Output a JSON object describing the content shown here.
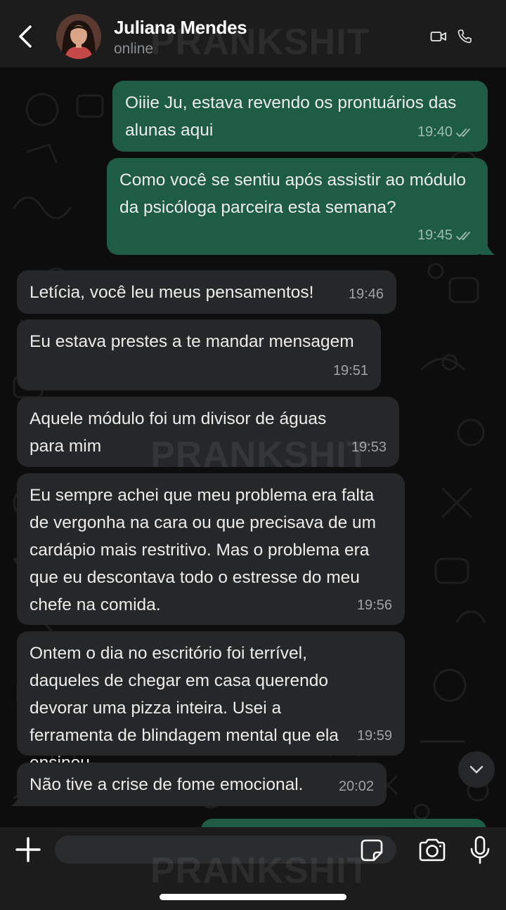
{
  "contact": {
    "name": "Juliana Mendes",
    "status": "online"
  },
  "watermark": "PRANKSHIT",
  "messages": [
    {
      "direction": "out",
      "text": "Oiiie Ju, estava revendo os prontuários das alunas aqui",
      "time": "19:40",
      "read": true
    },
    {
      "direction": "out",
      "text": "Como você se sentiu após assistir ao módulo da psicóloga parceira esta semana?",
      "time": "19:45",
      "read": true
    },
    {
      "direction": "in",
      "text": "Letícia, você leu meus pensamentos!",
      "time": "19:46"
    },
    {
      "direction": "in",
      "text": "Eu estava prestes a te mandar mensagem",
      "time": "19:51"
    },
    {
      "direction": "in",
      "text": "Aquele módulo foi um divisor de águas para mim",
      "time": "19:53"
    },
    {
      "direction": "in",
      "text": "Eu sempre achei que meu problema era falta de vergonha na cara ou que precisava de um cardápio mais restritivo. Mas o problema era que eu descontava todo o estresse do meu chefe na comida.",
      "time": "19:56"
    },
    {
      "direction": "in",
      "text": "Ontem o dia no escritório foi terrível, daqueles de chegar em casa querendo devorar uma pizza inteira. Usei a ferramenta de blindagem mental que ela ensinou.",
      "time": "19:59"
    },
    {
      "direction": "in",
      "text": "Não tive a crise de fome emocional.",
      "time": "20:02"
    }
  ],
  "composer": {
    "value": "",
    "placeholder": ""
  },
  "icons": {
    "back": "chevron-left-icon",
    "video": "video-camera-icon",
    "call": "phone-icon",
    "plus": "plus-icon",
    "sticker": "sticker-icon",
    "camera": "camera-icon",
    "mic": "microphone-icon",
    "scroll": "chevron-down-icon",
    "ticks": "double-check-icon"
  },
  "colors": {
    "outgoing_bubble": "#1f5c45",
    "incoming_bubble": "#262728",
    "header": "#1c1c1c",
    "background": "#0d0d0d"
  }
}
